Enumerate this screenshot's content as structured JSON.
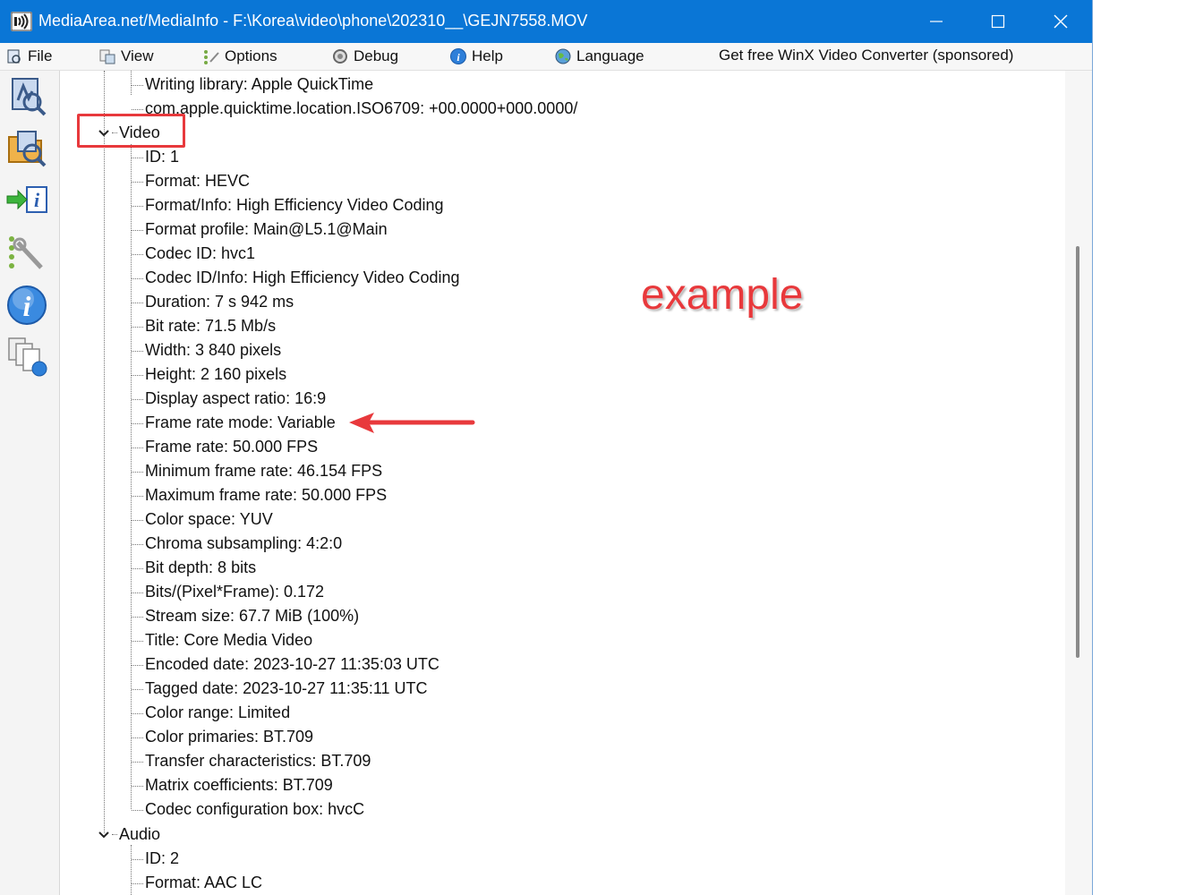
{
  "window": {
    "title": "MediaArea.net/MediaInfo - F:\\Korea\\video\\phone\\202310__\\GEJN7558.MOV"
  },
  "menu": {
    "items": [
      {
        "label": "File",
        "icon": "file-icon"
      },
      {
        "label": "View",
        "icon": "view-icon"
      },
      {
        "label": "Options",
        "icon": "options-icon"
      },
      {
        "label": "Debug",
        "icon": "debug-icon"
      },
      {
        "label": "Help",
        "icon": "help-icon"
      },
      {
        "label": "Language",
        "icon": "language-icon"
      }
    ],
    "sponsor": "Get free WinX Video Converter (sponsored)"
  },
  "tree": {
    "top_rows": [
      "Writing library: Apple QuickTime",
      "com.apple.quicktime.location.ISO6709: +00.0000+000.0000/"
    ],
    "video_label": "Video",
    "video_rows": [
      "ID: 1",
      "Format: HEVC",
      "Format/Info: High Efficiency Video Coding",
      "Format profile: Main@L5.1@Main",
      "Codec ID: hvc1",
      "Codec ID/Info: High Efficiency Video Coding",
      "Duration: 7 s 942 ms",
      "Bit rate: 71.5 Mb/s",
      "Width: 3 840 pixels",
      "Height: 2 160 pixels",
      "Display aspect ratio: 16:9",
      "Frame rate mode: Variable",
      "Frame rate: 50.000 FPS",
      "Minimum frame rate: 46.154 FPS",
      "Maximum frame rate: 50.000 FPS",
      "Color space: YUV",
      "Chroma subsampling: 4:2:0",
      "Bit depth: 8 bits",
      "Bits/(Pixel*Frame): 0.172",
      "Stream size: 67.7 MiB (100%)",
      "Title: Core Media Video",
      "Encoded date: 2023-10-27 11:35:03 UTC",
      "Tagged date: 2023-10-27 11:35:11 UTC",
      "Color range: Limited",
      "Color primaries: BT.709",
      "Transfer characteristics: BT.709",
      "Matrix coefficients: BT.709",
      "Codec configuration box: hvcC"
    ],
    "audio_label": "Audio",
    "audio_rows": [
      "ID: 2",
      "Format: AAC LC"
    ]
  },
  "annotation": {
    "text": "example",
    "color": "#e8393c"
  },
  "colors": {
    "titlebar": "#0a76d6",
    "accent_red": "#e8393c"
  }
}
